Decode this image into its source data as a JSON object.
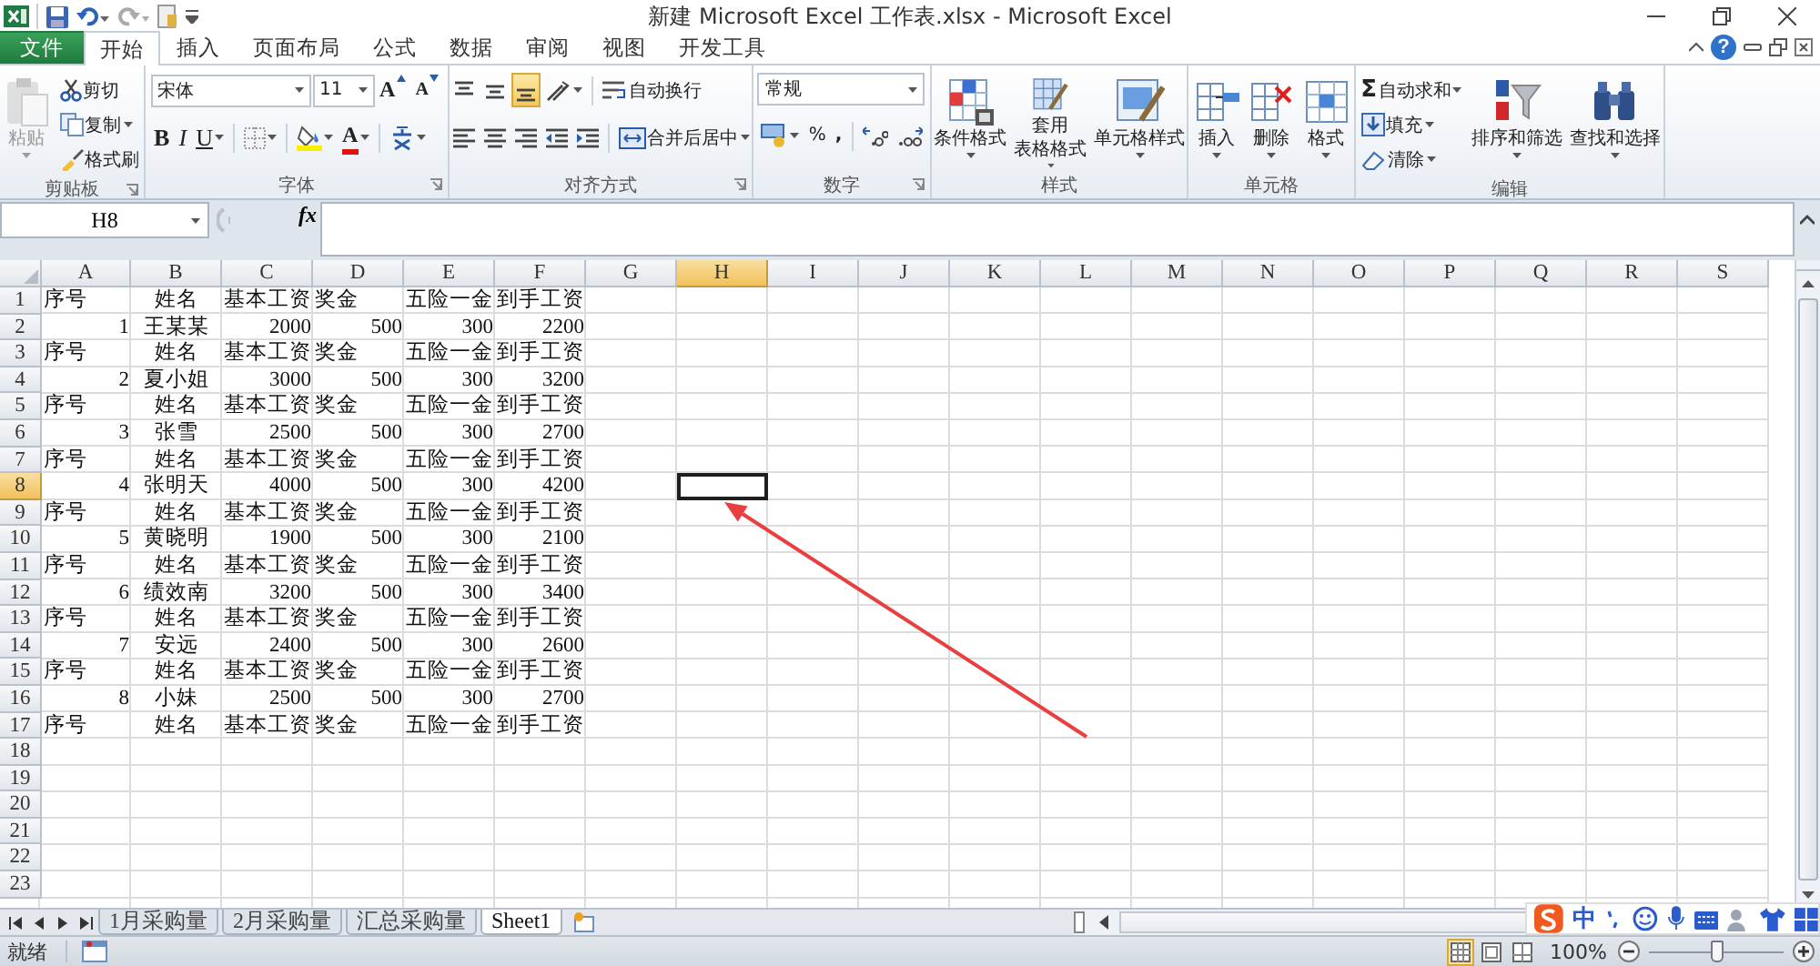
{
  "window": {
    "title": "新建 Microsoft Excel 工作表.xlsx - Microsoft Excel"
  },
  "tabs": {
    "items": [
      {
        "label": "文件",
        "kind": "file",
        "selected": false
      },
      {
        "label": "开始",
        "kind": "tab",
        "selected": true
      },
      {
        "label": "插入",
        "kind": "tab",
        "selected": false
      },
      {
        "label": "页面布局",
        "kind": "tab",
        "selected": false
      },
      {
        "label": "公式",
        "kind": "tab",
        "selected": false
      },
      {
        "label": "数据",
        "kind": "tab",
        "selected": false
      },
      {
        "label": "审阅",
        "kind": "tab",
        "selected": false
      },
      {
        "label": "视图",
        "kind": "tab",
        "selected": false
      },
      {
        "label": "开发工具",
        "kind": "tab",
        "selected": false
      }
    ],
    "help": "?"
  },
  "ribbon": {
    "clipboard": {
      "title": "剪贴板",
      "paste": {
        "label": "粘贴",
        "disabled": true
      },
      "cut": "剪切",
      "copy": "复制",
      "format_painter": "格式刷"
    },
    "font": {
      "title": "字体",
      "font_name": "宋体",
      "font_size": "11",
      "grow": "A",
      "shrink": "A",
      "bold": "B",
      "italic": "I",
      "underline": "U",
      "font_color": "A"
    },
    "alignment": {
      "title": "对齐方式",
      "vertical_align": [
        {
          "kind": "top",
          "selected": false
        },
        {
          "kind": "middle",
          "selected": false
        },
        {
          "kind": "bottom",
          "selected": true
        }
      ],
      "horizontal_align": [
        {
          "kind": "left",
          "selected": false
        },
        {
          "kind": "center",
          "selected": false
        },
        {
          "kind": "right",
          "selected": false
        }
      ],
      "wrap_text": "自动换行",
      "merge_center": "合并后居中"
    },
    "number": {
      "title": "数字",
      "format": "常规",
      "percent": "%",
      "comma": ","
    },
    "styles": {
      "title": "样式",
      "buttons": [
        {
          "kind": "conditional",
          "lines": [
            "条件格式"
          ]
        },
        {
          "kind": "table",
          "lines": [
            "套用",
            "表格格式"
          ]
        },
        {
          "kind": "cell",
          "lines": [
            "单元格样式"
          ]
        }
      ]
    },
    "cells": {
      "title": "单元格",
      "buttons": [
        {
          "kind": "insert",
          "label": "插入"
        },
        {
          "kind": "delete",
          "label": "删除"
        },
        {
          "kind": "format",
          "label": "格式"
        }
      ]
    },
    "editing": {
      "title": "编辑",
      "sigma": "Σ",
      "autosum": "自动求和",
      "fill": "填充",
      "clear": "清除",
      "sort_filter": "排序和筛选",
      "find_select": "查找和选择"
    }
  },
  "formula_bar": {
    "name_box": "H8",
    "fx": "fx"
  },
  "sheet": {
    "columns": [
      {
        "label": "A",
        "selected": false
      },
      {
        "label": "B",
        "selected": false
      },
      {
        "label": "C",
        "selected": false
      },
      {
        "label": "D",
        "selected": false
      },
      {
        "label": "E",
        "selected": false
      },
      {
        "label": "F",
        "selected": false
      },
      {
        "label": "G",
        "selected": false
      },
      {
        "label": "H",
        "selected": true
      },
      {
        "label": "I",
        "selected": false
      },
      {
        "label": "J",
        "selected": false
      },
      {
        "label": "K",
        "selected": false
      },
      {
        "label": "L",
        "selected": false
      },
      {
        "label": "M",
        "selected": false
      },
      {
        "label": "N",
        "selected": false
      },
      {
        "label": "O",
        "selected": false
      },
      {
        "label": "P",
        "selected": false
      },
      {
        "label": "Q",
        "selected": false
      },
      {
        "label": "R",
        "selected": false
      },
      {
        "label": "S",
        "selected": false
      }
    ],
    "rows": [
      {
        "label": "1",
        "selected": false,
        "kind": "header",
        "cells": [
          "序号",
          "姓名",
          "基本工资",
          "奖金",
          "五险一金",
          "到手工资"
        ]
      },
      {
        "label": "2",
        "selected": false,
        "kind": "data",
        "cells": [
          "1",
          "王某某",
          "2000",
          "500",
          "300",
          "2200"
        ]
      },
      {
        "label": "3",
        "selected": false,
        "kind": "header",
        "cells": [
          "序号",
          "姓名",
          "基本工资",
          "奖金",
          "五险一金",
          "到手工资"
        ]
      },
      {
        "label": "4",
        "selected": false,
        "kind": "data",
        "cells": [
          "2",
          "夏小姐",
          "3000",
          "500",
          "300",
          "3200"
        ]
      },
      {
        "label": "5",
        "selected": false,
        "kind": "header",
        "cells": [
          "序号",
          "姓名",
          "基本工资",
          "奖金",
          "五险一金",
          "到手工资"
        ]
      },
      {
        "label": "6",
        "selected": false,
        "kind": "data",
        "cells": [
          "3",
          "张雪",
          "2500",
          "500",
          "300",
          "2700"
        ]
      },
      {
        "label": "7",
        "selected": false,
        "kind": "header",
        "cells": [
          "序号",
          "姓名",
          "基本工资",
          "奖金",
          "五险一金",
          "到手工资"
        ]
      },
      {
        "label": "8",
        "selected": true,
        "kind": "data",
        "cells": [
          "4",
          "张明天",
          "4000",
          "500",
          "300",
          "4200"
        ]
      },
      {
        "label": "9",
        "selected": false,
        "kind": "header",
        "cells": [
          "序号",
          "姓名",
          "基本工资",
          "奖金",
          "五险一金",
          "到手工资"
        ]
      },
      {
        "label": "10",
        "selected": false,
        "kind": "data",
        "cells": [
          "5",
          "黄晓明",
          "1900",
          "500",
          "300",
          "2100"
        ]
      },
      {
        "label": "11",
        "selected": false,
        "kind": "header",
        "cells": [
          "序号",
          "姓名",
          "基本工资",
          "奖金",
          "五险一金",
          "到手工资"
        ]
      },
      {
        "label": "12",
        "selected": false,
        "kind": "data",
        "cells": [
          "6",
          "绩效南",
          "3200",
          "500",
          "300",
          "3400"
        ]
      },
      {
        "label": "13",
        "selected": false,
        "kind": "header",
        "cells": [
          "序号",
          "姓名",
          "基本工资",
          "奖金",
          "五险一金",
          "到手工资"
        ]
      },
      {
        "label": "14",
        "selected": false,
        "kind": "data",
        "cells": [
          "7",
          "安远",
          "2400",
          "500",
          "300",
          "2600"
        ]
      },
      {
        "label": "15",
        "selected": false,
        "kind": "header",
        "cells": [
          "序号",
          "姓名",
          "基本工资",
          "奖金",
          "五险一金",
          "到手工资"
        ]
      },
      {
        "label": "16",
        "selected": false,
        "kind": "data",
        "cells": [
          "8",
          "小妹",
          "2500",
          "500",
          "300",
          "2700"
        ]
      },
      {
        "label": "17",
        "selected": false,
        "kind": "header",
        "cells": [
          "序号",
          "姓名",
          "基本工资",
          "奖金",
          "五险一金",
          "到手工资"
        ]
      },
      {
        "label": "18",
        "selected": false,
        "kind": "empty"
      },
      {
        "label": "19",
        "selected": false,
        "kind": "empty"
      },
      {
        "label": "20",
        "selected": false,
        "kind": "empty"
      },
      {
        "label": "21",
        "selected": false,
        "kind": "empty"
      },
      {
        "label": "22",
        "selected": false,
        "kind": "empty"
      },
      {
        "label": "23",
        "selected": false,
        "kind": "empty"
      }
    ]
  },
  "sheet_tabs": [
    {
      "label": "1月采购量",
      "selected": false
    },
    {
      "label": "2月采购量",
      "selected": false
    },
    {
      "label": "汇总采购量",
      "selected": false
    },
    {
      "label": "Sheet1",
      "selected": true
    }
  ],
  "ime_bar": {
    "mode": "中"
  },
  "status_bar": {
    "status": "就绪",
    "views": [
      {
        "kind": "normal",
        "selected": true
      },
      {
        "kind": "page_layout",
        "selected": false
      },
      {
        "kind": "page_break",
        "selected": false
      }
    ],
    "zoom": "100%",
    "zoom_slider": {
      "level": 0.5
    }
  }
}
